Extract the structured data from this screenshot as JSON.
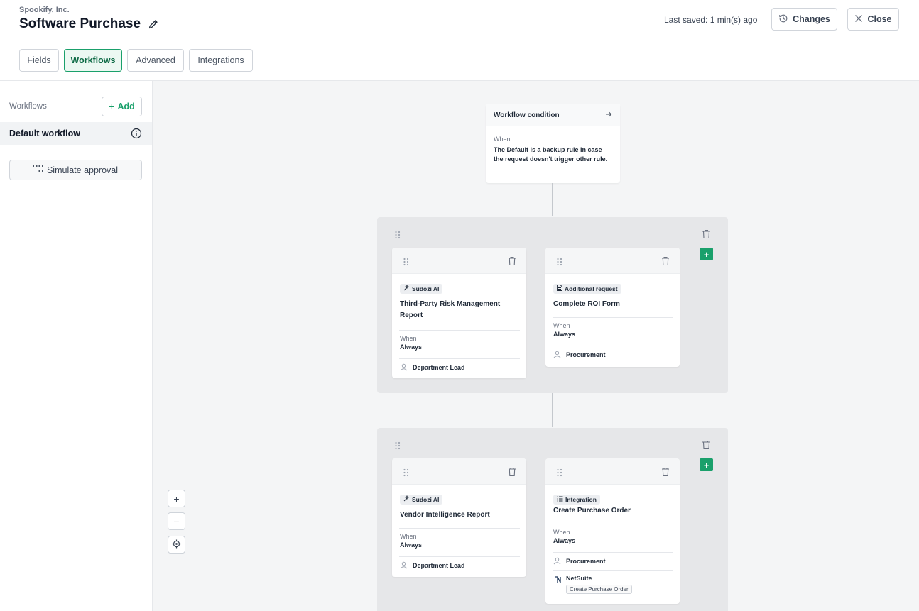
{
  "header": {
    "company": "Spookify, Inc.",
    "title": "Software Purchase",
    "last_saved": "Last saved: 1 min(s) ago",
    "changes_label": "Changes",
    "close_label": "Close"
  },
  "tabs": [
    {
      "label": "Fields",
      "active": false
    },
    {
      "label": "Workflows",
      "active": true
    },
    {
      "label": "Advanced",
      "active": false
    },
    {
      "label": "Integrations",
      "active": false
    }
  ],
  "sidebar": {
    "section_label": "Workflows",
    "add_label": "Add",
    "items": [
      {
        "label": "Default workflow",
        "selected": true
      }
    ],
    "simulate_label": "Simulate approval"
  },
  "canvas": {
    "zoom_in": "+",
    "zoom_out": "−",
    "condition": {
      "title": "Workflow condition",
      "when_label": "When",
      "text": "The Default is a backup rule in case the request doesn't trigger other rule."
    },
    "groups": [
      {
        "steps": [
          {
            "badge": "Sudozi AI",
            "badge_icon": "sparkle-icon",
            "title": "Third-Party Risk Management Report",
            "when_label": "When",
            "when_value": "Always",
            "assignee": "Department Lead"
          },
          {
            "badge": "Additional request",
            "badge_icon": "document-icon",
            "title": "Complete ROI Form",
            "when_label": "When",
            "when_value": "Always",
            "assignee": "Procurement"
          }
        ]
      },
      {
        "steps": [
          {
            "badge": "Sudozi AI",
            "badge_icon": "sparkle-icon",
            "title": "Vendor Intelligence Report",
            "when_label": "When",
            "when_value": "Always",
            "assignee": "Department Lead"
          },
          {
            "badge": "Integration",
            "badge_icon": "list-icon",
            "title": "Create Purchase Order",
            "when_label": "When",
            "when_value": "Always",
            "assignee": "Procurement",
            "integration_name": "NetSuite",
            "integration_action": "Create Purchase Order"
          }
        ]
      }
    ]
  },
  "colors": {
    "accent": "#1aa06b",
    "accent_bg": "#ecf8f2",
    "canvas_bg": "#f4f5f6",
    "group_bg": "#e6e7e9"
  }
}
